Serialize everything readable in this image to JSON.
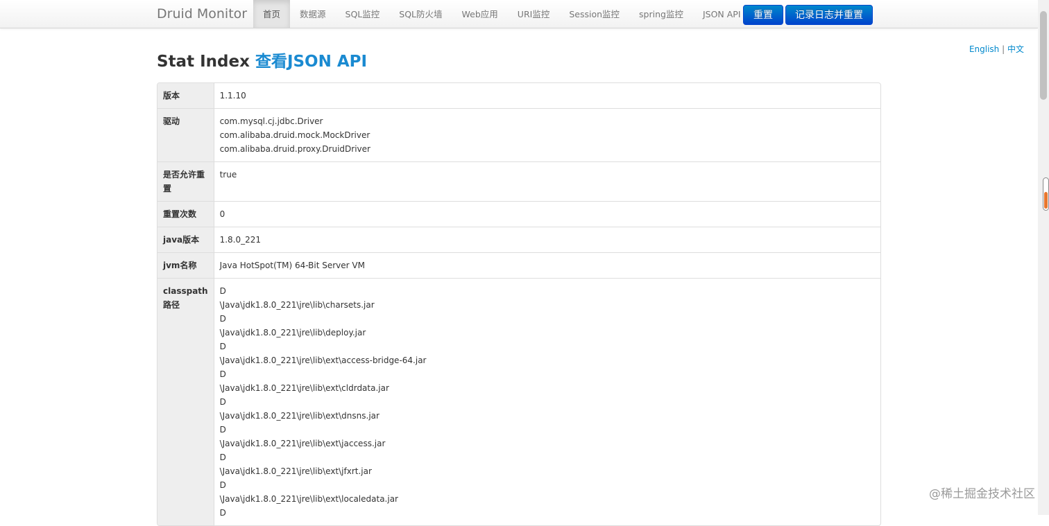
{
  "navbar": {
    "brand": "Druid Monitor",
    "items": [
      "首页",
      "数据源",
      "SQL监控",
      "SQL防火墙",
      "Web应用",
      "URI监控",
      "Session监控",
      "spring监控",
      "JSON API"
    ],
    "active_index": 0,
    "reset_label": "重置",
    "log_reset_label": "记录日志并重置"
  },
  "lang": {
    "english": "English",
    "separator": "|",
    "chinese": "中文"
  },
  "heading": {
    "title": "Stat Index",
    "link": "查看JSON API"
  },
  "rows": [
    {
      "label": "版本",
      "lines": [
        "1.1.10"
      ]
    },
    {
      "label": "驱动",
      "lines": [
        "com.mysql.cj.jdbc.Driver",
        "com.alibaba.druid.mock.MockDriver",
        "com.alibaba.druid.proxy.DruidDriver"
      ]
    },
    {
      "label": "是否允许重置",
      "lines": [
        "true"
      ]
    },
    {
      "label": "重置次数",
      "lines": [
        "0"
      ]
    },
    {
      "label": "java版本",
      "lines": [
        "1.8.0_221"
      ]
    },
    {
      "label": "jvm名称",
      "lines": [
        "Java HotSpot(TM) 64-Bit Server VM"
      ]
    },
    {
      "label": "classpath路径",
      "lines": [
        "D",
        "\\Java\\jdk1.8.0_221\\jre\\lib\\charsets.jar",
        "D",
        "\\Java\\jdk1.8.0_221\\jre\\lib\\deploy.jar",
        "D",
        "\\Java\\jdk1.8.0_221\\jre\\lib\\ext\\access-bridge-64.jar",
        "D",
        "\\Java\\jdk1.8.0_221\\jre\\lib\\ext\\cldrdata.jar",
        "D",
        "\\Java\\jdk1.8.0_221\\jre\\lib\\ext\\dnsns.jar",
        "D",
        "\\Java\\jdk1.8.0_221\\jre\\lib\\ext\\jaccess.jar",
        "D",
        "\\Java\\jdk1.8.0_221\\jre\\lib\\ext\\jfxrt.jar",
        "D",
        "\\Java\\jdk1.8.0_221\\jre\\lib\\ext\\localedata.jar",
        "D"
      ]
    }
  ],
  "watermark": "@稀土掘金技术社区"
}
